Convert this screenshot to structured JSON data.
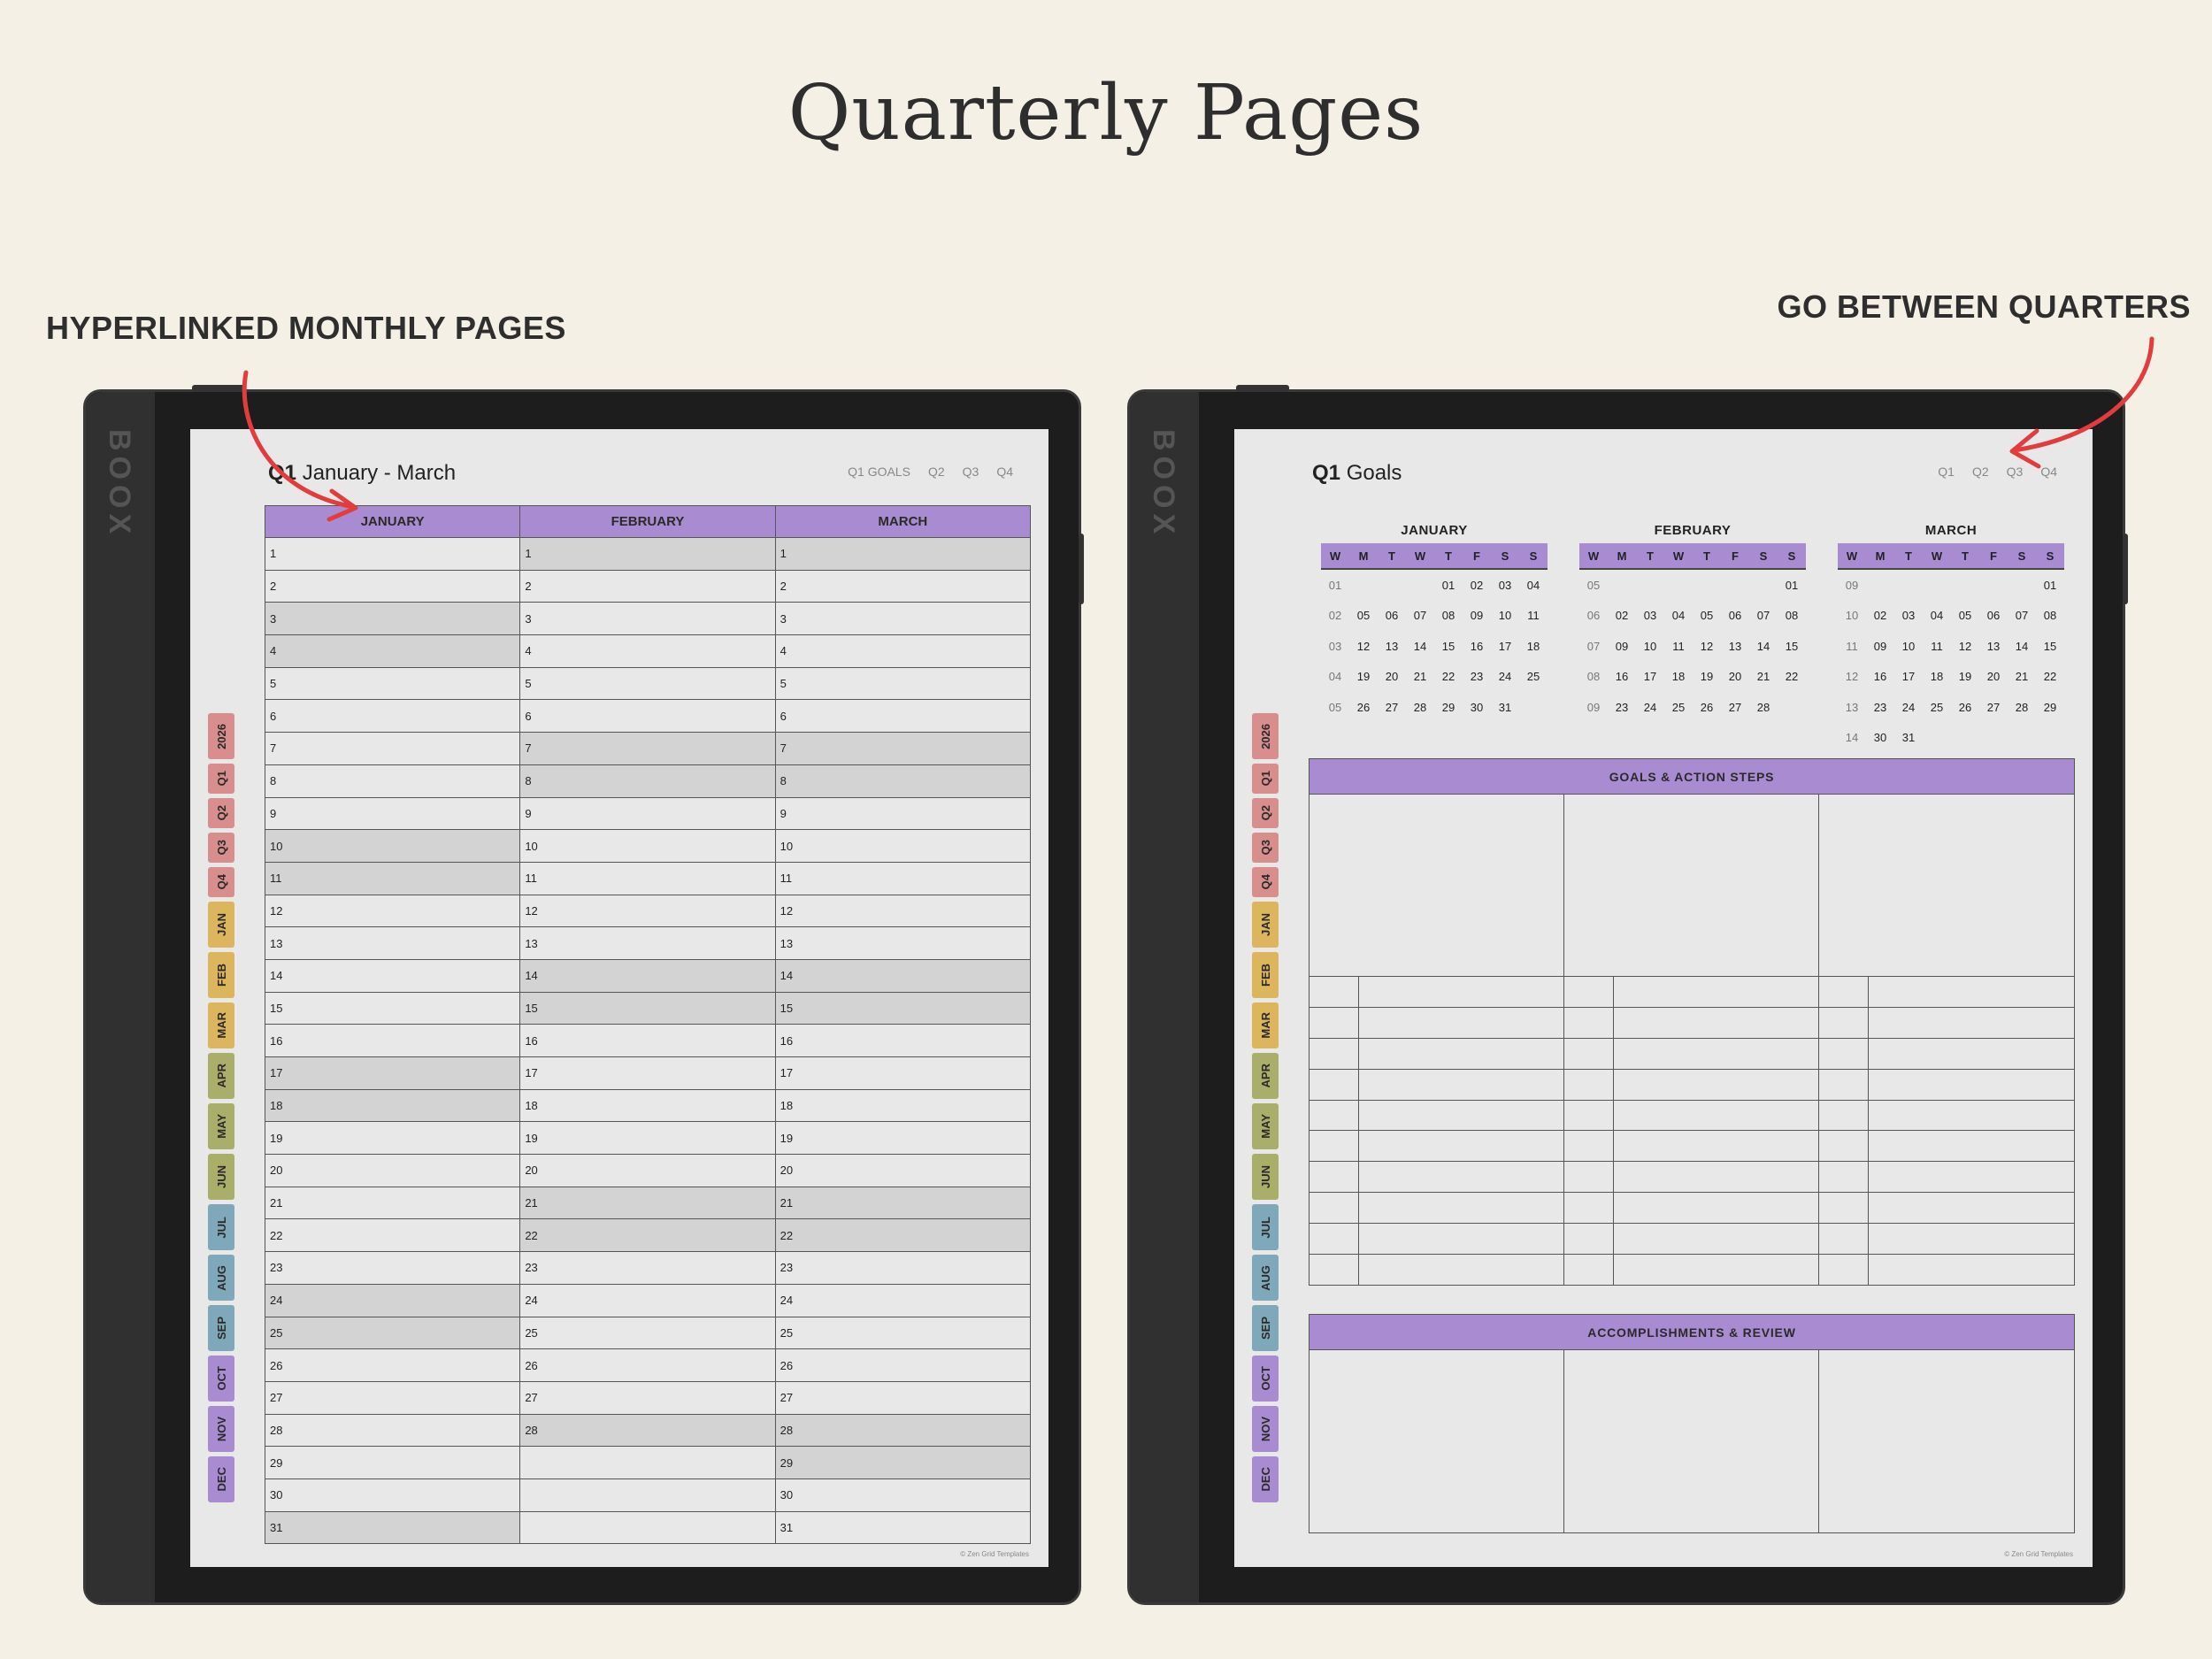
{
  "page": {
    "title": "Quarterly Pages",
    "callout_left": "HYPERLINKED MONTHLY PAGES",
    "callout_right": "GO BETWEEN QUARTERS"
  },
  "device": {
    "brand": "BOOX"
  },
  "colors": {
    "background": "#f5f0e5",
    "accent": "#a98bd1",
    "tab_red": "#d98e8e",
    "tab_yellow": "#dcb55c",
    "tab_green": "#a9ae6a",
    "tab_blue": "#7fa9bb",
    "tab_purple": "#a98bd1"
  },
  "tabs": [
    {
      "label": "2026",
      "color": "#d98e8e"
    },
    {
      "label": "Q1",
      "color": "#d98e8e"
    },
    {
      "label": "Q2",
      "color": "#d98e8e"
    },
    {
      "label": "Q3",
      "color": "#d98e8e"
    },
    {
      "label": "Q4",
      "color": "#d98e8e"
    },
    {
      "label": "JAN",
      "color": "#dcb55c"
    },
    {
      "label": "FEB",
      "color": "#dcb55c"
    },
    {
      "label": "MAR",
      "color": "#dcb55c"
    },
    {
      "label": "APR",
      "color": "#a9ae6a"
    },
    {
      "label": "MAY",
      "color": "#a9ae6a"
    },
    {
      "label": "JUN",
      "color": "#a9ae6a"
    },
    {
      "label": "JUL",
      "color": "#7fa9bb"
    },
    {
      "label": "AUG",
      "color": "#7fa9bb"
    },
    {
      "label": "SEP",
      "color": "#7fa9bb"
    },
    {
      "label": "OCT",
      "color": "#a98bd1"
    },
    {
      "label": "NOV",
      "color": "#a98bd1"
    },
    {
      "label": "DEC",
      "color": "#a98bd1"
    }
  ],
  "left_screen": {
    "header_bold": "Q1",
    "header_text": "January - March",
    "nav": [
      "Q1 GOALS",
      "Q2",
      "Q3",
      "Q4"
    ],
    "columns": [
      "JANUARY",
      "FEBRUARY",
      "MARCH"
    ],
    "days_in_month": [
      31,
      28,
      31
    ],
    "weekend_days": [
      [
        3,
        4,
        10,
        11,
        17,
        18,
        24,
        25,
        31
      ],
      [
        1,
        7,
        8,
        14,
        15,
        21,
        22,
        28
      ],
      [
        1,
        7,
        8,
        14,
        15,
        21,
        22,
        28,
        29
      ]
    ],
    "copyright": "© Zen Grid Templates"
  },
  "right_screen": {
    "header_bold": "Q1",
    "header_text": "Goals",
    "nav": [
      "Q1",
      "Q2",
      "Q3",
      "Q4"
    ],
    "weekday_header": [
      "W",
      "M",
      "T",
      "W",
      "T",
      "F",
      "S",
      "S"
    ],
    "calendars": [
      {
        "title": "JANUARY",
        "rows": [
          [
            "01",
            "",
            "",
            "",
            "01",
            "02",
            "03",
            "04"
          ],
          [
            "02",
            "05",
            "06",
            "07",
            "08",
            "09",
            "10",
            "11"
          ],
          [
            "03",
            "12",
            "13",
            "14",
            "15",
            "16",
            "17",
            "18"
          ],
          [
            "04",
            "19",
            "20",
            "21",
            "22",
            "23",
            "24",
            "25"
          ],
          [
            "05",
            "26",
            "27",
            "28",
            "29",
            "30",
            "31",
            ""
          ]
        ]
      },
      {
        "title": "FEBRUARY",
        "rows": [
          [
            "05",
            "",
            "",
            "",
            "",
            "",
            "",
            "01"
          ],
          [
            "06",
            "02",
            "03",
            "04",
            "05",
            "06",
            "07",
            "08"
          ],
          [
            "07",
            "09",
            "10",
            "11",
            "12",
            "13",
            "14",
            "15"
          ],
          [
            "08",
            "16",
            "17",
            "18",
            "19",
            "20",
            "21",
            "22"
          ],
          [
            "09",
            "23",
            "24",
            "25",
            "26",
            "27",
            "28",
            ""
          ]
        ]
      },
      {
        "title": "MARCH",
        "rows": [
          [
            "09",
            "",
            "",
            "",
            "",
            "",
            "",
            "01"
          ],
          [
            "10",
            "02",
            "03",
            "04",
            "05",
            "06",
            "07",
            "08"
          ],
          [
            "11",
            "09",
            "10",
            "11",
            "12",
            "13",
            "14",
            "15"
          ],
          [
            "12",
            "16",
            "17",
            "18",
            "19",
            "20",
            "21",
            "22"
          ],
          [
            "13",
            "23",
            "24",
            "25",
            "26",
            "27",
            "28",
            "29"
          ],
          [
            "14",
            "30",
            "31",
            "",
            "",
            "",
            "",
            ""
          ]
        ]
      }
    ],
    "goals_title": "GOALS & ACTION STEPS",
    "review_title": "ACCOMPLISHMENTS & REVIEW",
    "goal_line_rows": 10,
    "copyright": "© Zen Grid Templates"
  }
}
